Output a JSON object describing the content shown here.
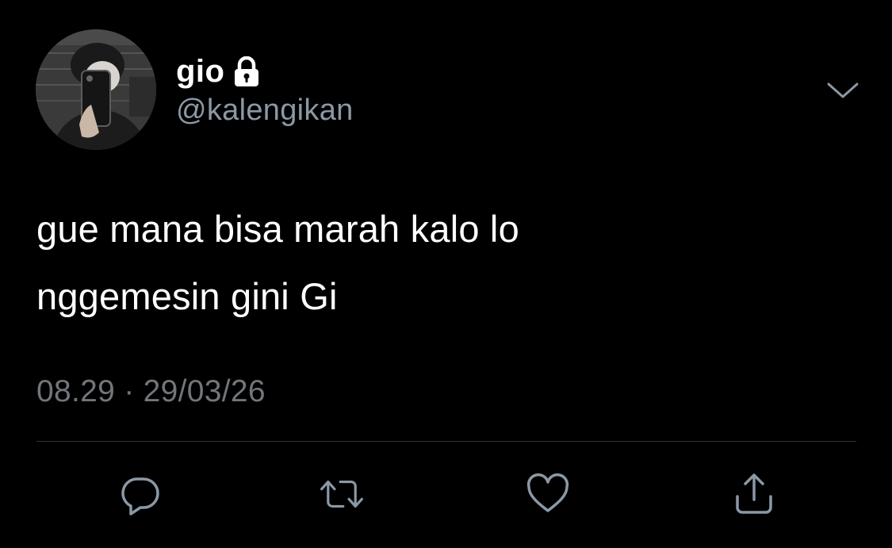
{
  "user": {
    "display_name": "gio",
    "handle": "@kalengikan",
    "avatar_icon": "avatar-photo",
    "protected_icon": "lock-icon"
  },
  "menu": {
    "icon": "chevron-down-icon"
  },
  "tweet": {
    "text_line_1": "gue mana bisa marah kalo lo",
    "text_line_2": "nggemesin gini Gi",
    "timestamp": "08.29 · 29/03/26"
  },
  "actions": [
    {
      "icon": "reply-icon"
    },
    {
      "icon": "retweet-icon"
    },
    {
      "icon": "like-icon"
    },
    {
      "icon": "share-icon"
    }
  ],
  "colors": {
    "background": "#000000",
    "text_primary": "#ffffff",
    "text_secondary": "#8b98a5",
    "timestamp": "#71767b",
    "divider": "#2f3336",
    "icon": "#8b98a5"
  }
}
